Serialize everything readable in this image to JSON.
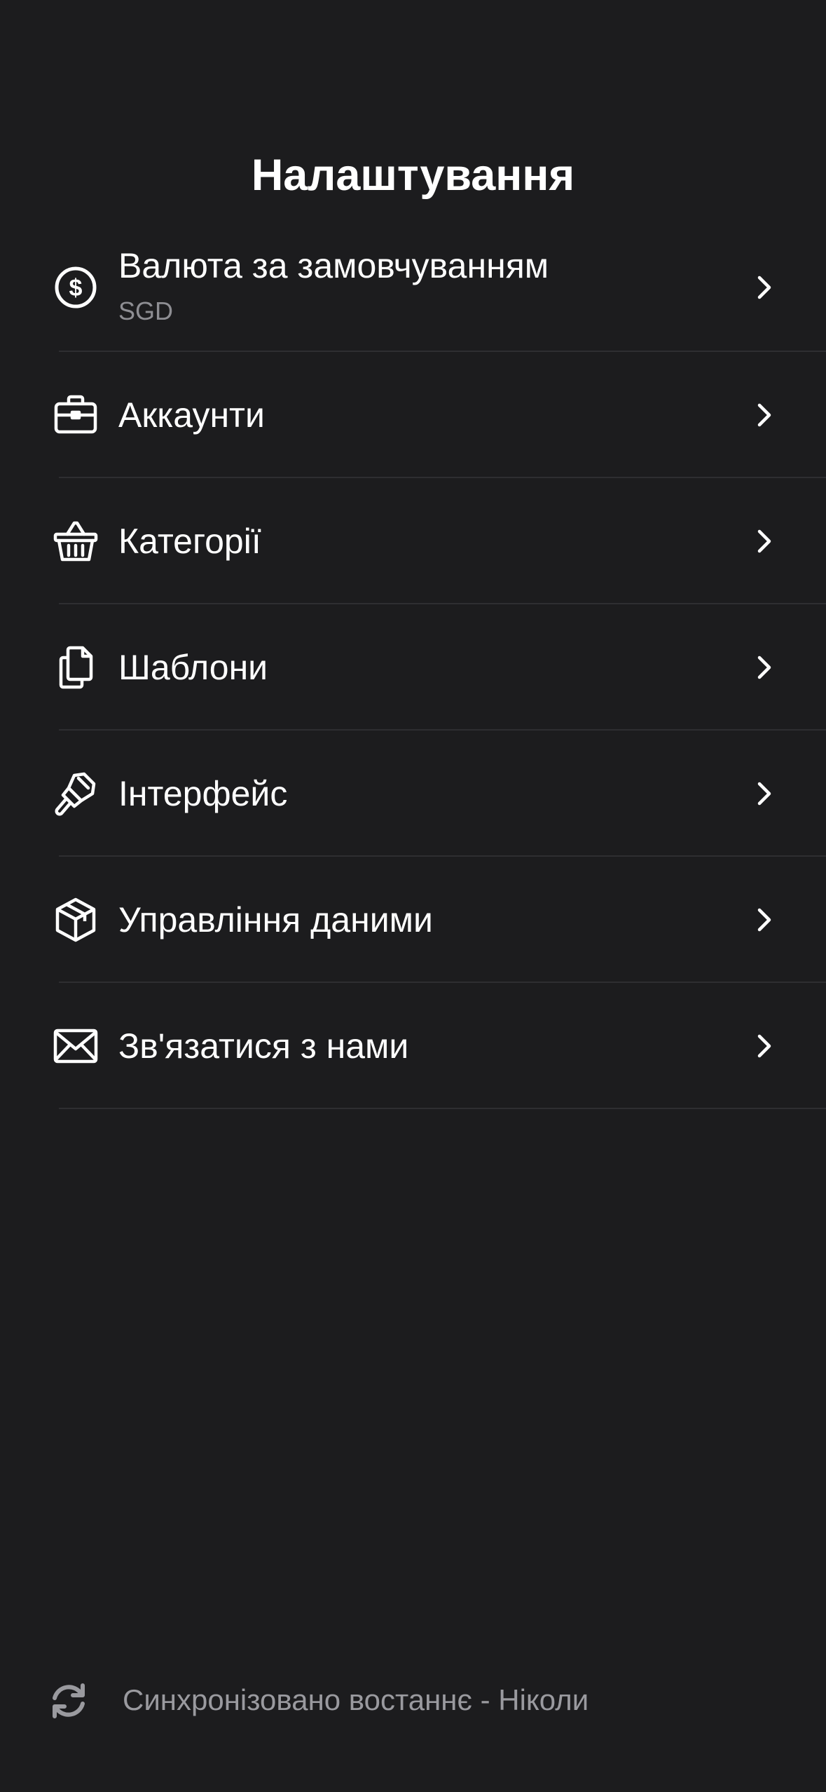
{
  "page": {
    "title": "Налаштування"
  },
  "settings": {
    "items": [
      {
        "label": "Валюта за замовчуванням",
        "value": "SGD",
        "icon": "dollar-circle-icon"
      },
      {
        "label": "Аккаунти",
        "icon": "briefcase-icon"
      },
      {
        "label": "Категорії",
        "icon": "basket-icon"
      },
      {
        "label": "Шаблони",
        "icon": "documents-icon"
      },
      {
        "label": "Інтерфейс",
        "icon": "paintbrush-icon"
      },
      {
        "label": "Управління даними",
        "icon": "box-icon"
      },
      {
        "label": "Зв'язатися з нами",
        "icon": "envelope-icon"
      }
    ]
  },
  "footer": {
    "sync_text": "Синхронізовано востаннє - Ніколи",
    "sync_icon": "sync-icon"
  },
  "colors": {
    "background": "#1c1c1e",
    "text": "#ffffff",
    "secondary_text": "#8e8e93",
    "divider": "#2e2e31"
  }
}
